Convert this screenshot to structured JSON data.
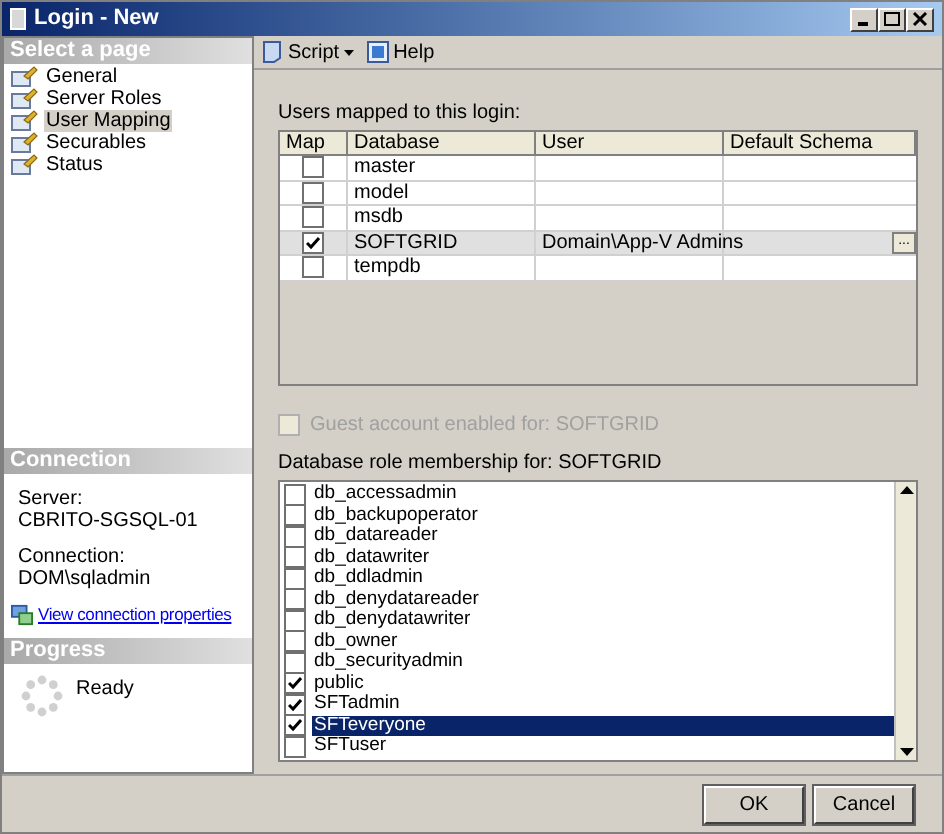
{
  "window": {
    "title": "Login - New"
  },
  "select_page": {
    "header": "Select a page",
    "items": [
      {
        "label": "General",
        "selected": false
      },
      {
        "label": "Server Roles",
        "selected": false
      },
      {
        "label": "User Mapping",
        "selected": true
      },
      {
        "label": "Securables",
        "selected": false
      },
      {
        "label": "Status",
        "selected": false
      }
    ]
  },
  "connection": {
    "header": "Connection",
    "server_label": "Server:",
    "server": "CBRITO-SGSQL-01",
    "connection_label": "Connection:",
    "connection": "DOM\\sqladmin",
    "link": "View connection properties"
  },
  "progress": {
    "header": "Progress",
    "status": "Ready"
  },
  "toolbar": {
    "script": "Script",
    "help": "Help"
  },
  "users_mapped": {
    "label": "Users mapped to this login:",
    "columns": [
      "Map",
      "Database",
      "User",
      "Default Schema"
    ],
    "rows": [
      {
        "checked": false,
        "selected": false,
        "database": "master",
        "user": ""
      },
      {
        "checked": false,
        "selected": false,
        "database": "model",
        "user": ""
      },
      {
        "checked": false,
        "selected": false,
        "database": "msdb",
        "user": ""
      },
      {
        "checked": true,
        "selected": true,
        "database": "SOFTGRID",
        "user": "Domain\\App-V Admins",
        "browse": "..."
      },
      {
        "checked": false,
        "selected": false,
        "database": "tempdb",
        "user": ""
      }
    ]
  },
  "guest": {
    "label": "Guest account enabled for: SOFTGRID",
    "checked": false,
    "disabled": true
  },
  "roles": {
    "label": "Database role membership for: SOFTGRID",
    "items": [
      {
        "name": "db_accessadmin",
        "checked": false,
        "selected": false
      },
      {
        "name": "db_backupoperator",
        "checked": false,
        "selected": false
      },
      {
        "name": "db_datareader",
        "checked": false,
        "selected": false
      },
      {
        "name": "db_datawriter",
        "checked": false,
        "selected": false
      },
      {
        "name": "db_ddladmin",
        "checked": false,
        "selected": false
      },
      {
        "name": "db_denydatareader",
        "checked": false,
        "selected": false
      },
      {
        "name": "db_denydatawriter",
        "checked": false,
        "selected": false
      },
      {
        "name": "db_owner",
        "checked": false,
        "selected": false
      },
      {
        "name": "db_securityadmin",
        "checked": false,
        "selected": false
      },
      {
        "name": "public",
        "checked": true,
        "selected": false
      },
      {
        "name": "SFTadmin",
        "checked": true,
        "selected": false
      },
      {
        "name": "SFTeveryone",
        "checked": true,
        "selected": true
      },
      {
        "name": "SFTuser",
        "checked": false,
        "selected": false
      }
    ]
  },
  "buttons": [
    "OK",
    "Cancel"
  ]
}
